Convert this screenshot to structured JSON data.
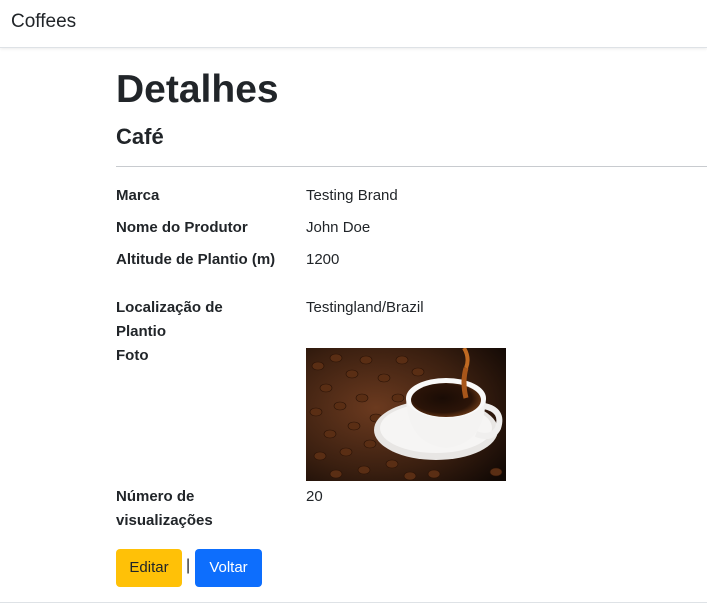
{
  "navbar": {
    "brand": "Coffees"
  },
  "page": {
    "title": "Detalhes",
    "subtitle": "Café"
  },
  "details": [
    {
      "label": "Marca",
      "value": "Testing Brand"
    },
    {
      "label": "Nome do Produtor",
      "value": "John Doe"
    },
    {
      "label": "Altitude de Plantio (m)",
      "value": "1200"
    },
    {
      "label": "Localização de Plantio",
      "value": "Testingland/Brazil"
    },
    {
      "label": "Foto",
      "value": ""
    },
    {
      "label": "Número de visualizações",
      "value": "20"
    }
  ],
  "actions": {
    "edit_label": "Editar",
    "separator": "|",
    "back_label": "Voltar"
  },
  "colors": {
    "warning": "#ffc107",
    "primary": "#0d6efd"
  }
}
